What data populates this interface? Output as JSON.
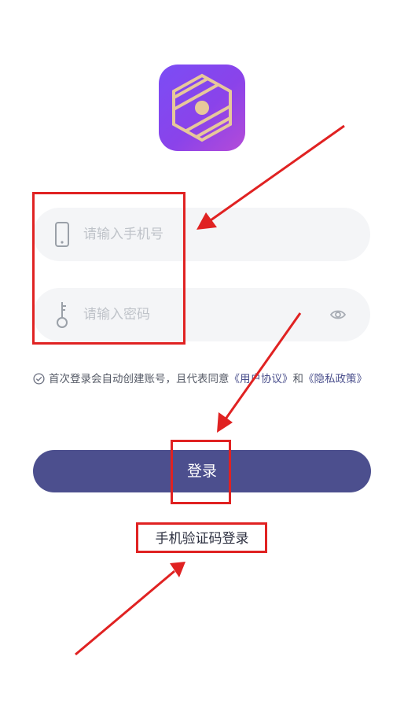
{
  "app": {
    "logo_icon": "hexagon-eye-logo-icon"
  },
  "form": {
    "phone_placeholder": "请输入手机号",
    "phone_icon": "phone-icon",
    "password_placeholder": "请输入密码",
    "password_icon": "key-icon",
    "visibility_icon": "eye-icon"
  },
  "agreement": {
    "check_icon": "check-circle-icon",
    "text_prefix": "首次登录会自动创建账号，且代表同意",
    "user_agreement": "《用户协议》",
    "and": "和",
    "privacy_policy": "《隐私政策》"
  },
  "actions": {
    "login_label": "登录",
    "sms_login_label": "手机验证码登录"
  },
  "colors": {
    "button": "#4c4f8e",
    "link": "#4a4f8c",
    "field_bg": "#f4f5f7",
    "annotation_red": "#e02222",
    "logo_gradient_start": "#7b4df5",
    "logo_gradient_end": "#b44bd8"
  }
}
